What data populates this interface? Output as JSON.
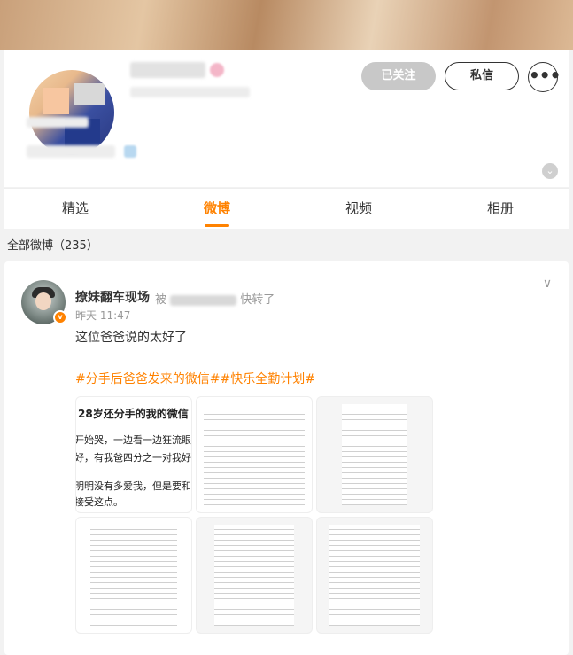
{
  "profile": {
    "follow_label": "已关注",
    "message_label": "私信",
    "more_label": "•••",
    "expand_icon": "chevron-down-icon"
  },
  "tabs": [
    {
      "label": "精选",
      "active": false
    },
    {
      "label": "微博",
      "active": true
    },
    {
      "label": "视频",
      "active": false
    },
    {
      "label": "相册",
      "active": false
    }
  ],
  "feed": {
    "count_label": "全部微博（235）"
  },
  "post": {
    "author": "撩妹翻车现场",
    "repost_prefix": "被",
    "repost_suffix": "快转了",
    "time": "昨天 11:47",
    "text": "这位爸爸说的太好了",
    "topics": "#分手后爸爸发来的微信##快乐全勤计划#",
    "verified_badge": "v",
    "image1_lines": [
      "28岁还分手的我的微信",
      "开始哭，一边看一边狂流眼泪，",
      "好，有我爸四分之一对我好，",
      "明明没有多爱我，但是要和我",
      "接受这点。"
    ]
  },
  "colors": {
    "accent": "#ff8200",
    "followed_bg": "#c8c8c8"
  }
}
